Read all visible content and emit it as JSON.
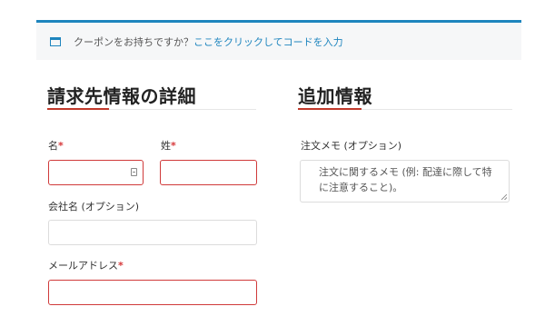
{
  "notice": {
    "text": "クーポンをお持ちですか？",
    "link": "ここをクリックしてコードを入力"
  },
  "billing": {
    "title": "請求先情報の詳細",
    "first_name_label": "名",
    "last_name_label": "姓",
    "company_label": "会社名 (オプション)",
    "email_label": "メールアドレス",
    "required_mark": "*"
  },
  "additional": {
    "title": "追加情報",
    "order_notes_label": "注文メモ (オプション)",
    "order_notes_placeholder": "注文に関するメモ (例: 配達に際して特に注意すること)。"
  },
  "colors": {
    "accent": "#1e85be",
    "error": "#d03a3a",
    "title_underline": "#c0392b"
  }
}
